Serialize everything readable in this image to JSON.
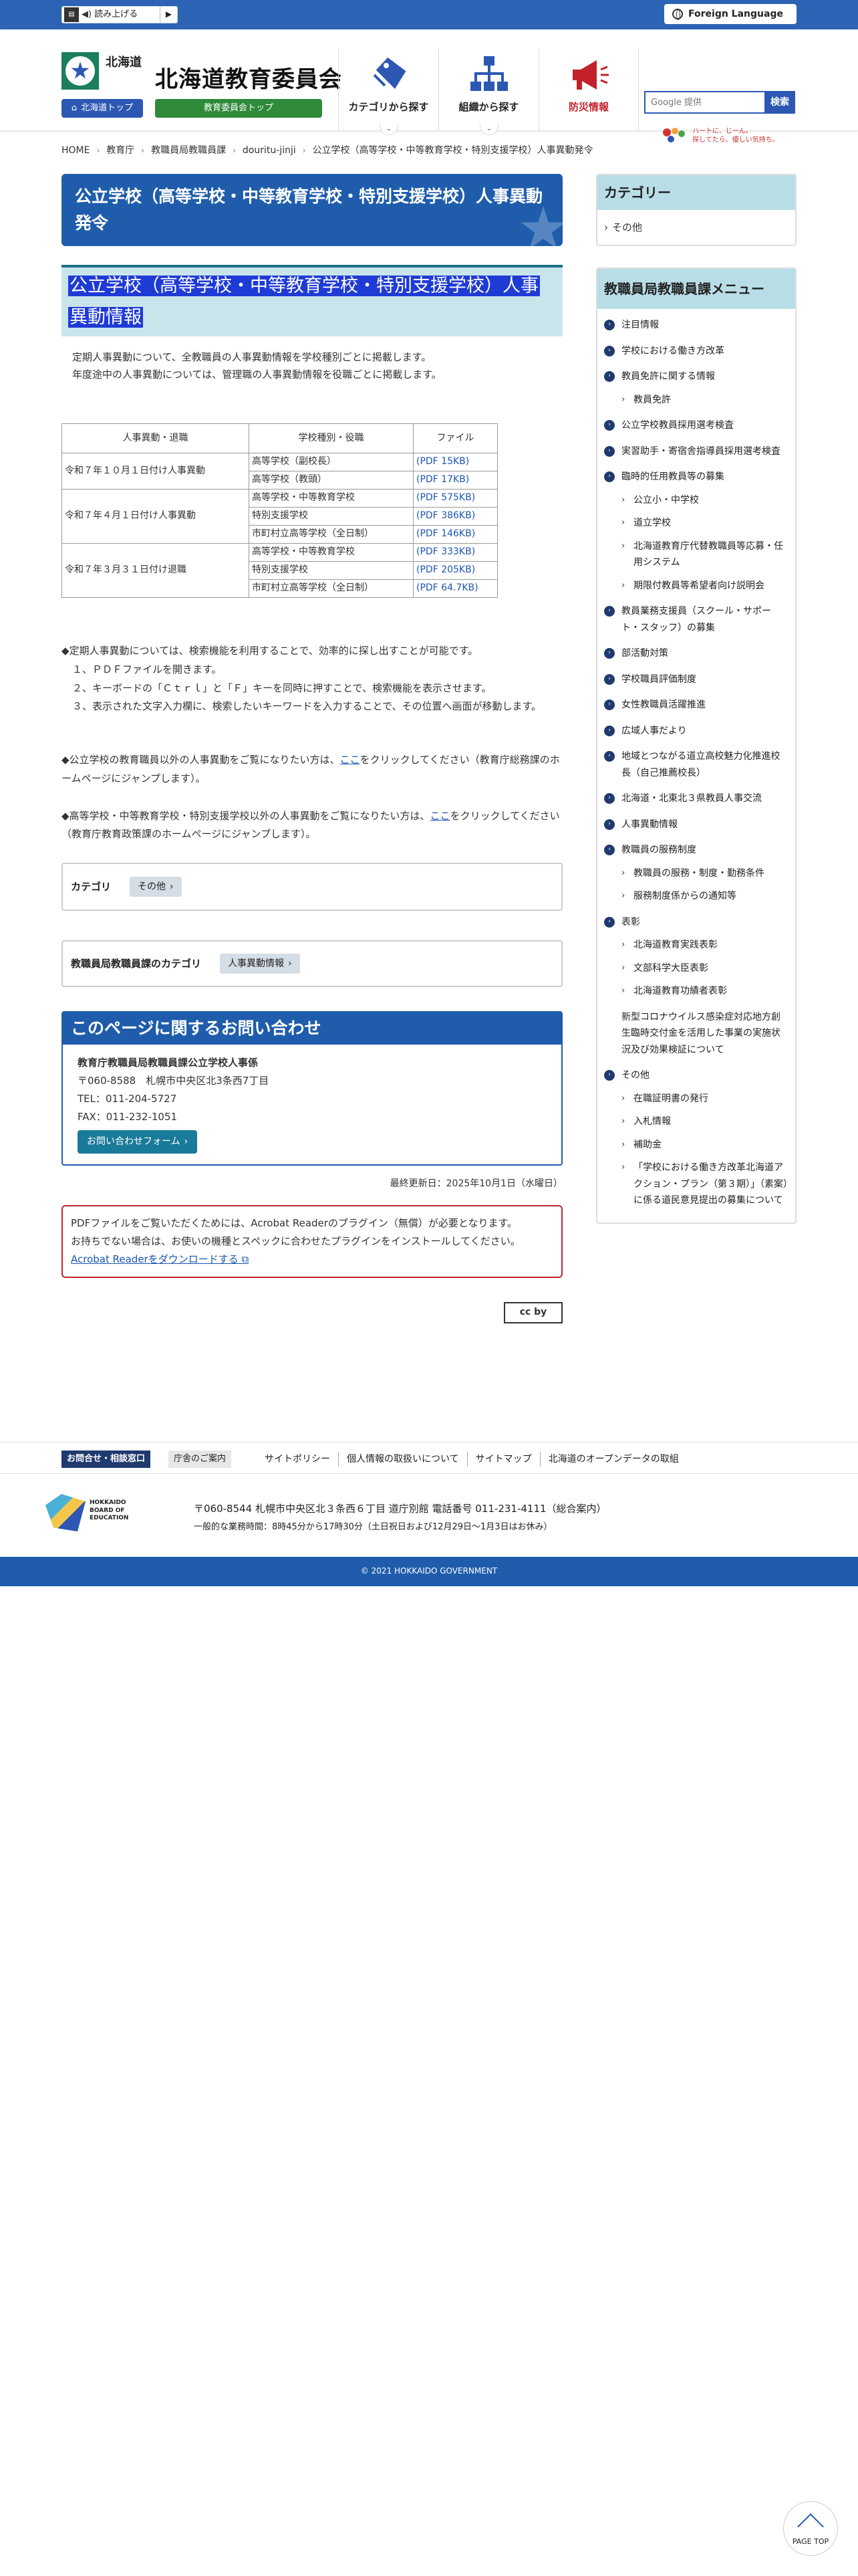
{
  "topbar": {
    "read_aloud": "読み上げる",
    "foreign_language": "Foreign Language"
  },
  "header": {
    "hokkaido": "北海道",
    "hokkaido_top": "北海道トップ",
    "board_title": "北海道教育委員会",
    "board_top": "教育委員会トップ",
    "nav": [
      "カテゴリから探す",
      "組織から探す",
      "防災情報"
    ],
    "search_placeholder": "Google 提供",
    "search_button": "検索",
    "slogan": [
      "ハートに、じーん。",
      "探してたら、優しい気持ち。"
    ]
  },
  "breadcrumb": [
    "HOME",
    "教育庁",
    "教職員局教職員課",
    "douritu-jinji",
    "公立学校（高等学校・中等教育学校・特別支援学校）人事異動発令"
  ],
  "main": {
    "page_title": "公立学校（高等学校・中等教育学校・特別支援学校）人事異動発令",
    "section_title": "公立学校（高等学校・中等教育学校・特別支援学校）人事異動情報",
    "intro": [
      "定期人事異動について、全教職員の人事異動情報を学校種別ごとに掲載します。",
      "年度途中の人事異動については、管理職の人事異動情報を役職ごとに掲載します。"
    ],
    "table": {
      "headers": [
        "人事異動・退職",
        "学校種別・役職",
        "ファイル"
      ],
      "groups": [
        {
          "label": "令和７年１０月１日付け人事異動",
          "rows": [
            {
              "type": "高等学校（副校長）",
              "file": "(PDF 15KB)"
            },
            {
              "type": "高等学校（教頭）",
              "file": "(PDF 17KB)"
            }
          ]
        },
        {
          "label": "令和７年４月１日付け人事異動",
          "rows": [
            {
              "type": "高等学校・中等教育学校",
              "file": "(PDF 575KB)"
            },
            {
              "type": "特別支援学校",
              "file": "(PDF 386KB)"
            },
            {
              "type": "市町村立高等学校（全日制）",
              "file": "(PDF 146KB)"
            }
          ]
        },
        {
          "label": "令和７年３月３１日付け退職",
          "rows": [
            {
              "type": "高等学校・中等教育学校",
              "file": "(PDF 333KB)"
            },
            {
              "type": "特別支援学校",
              "file": "(PDF 205KB)"
            },
            {
              "type": "市町村立高等学校（全日制）",
              "file": "(PDF 64.7KB)"
            }
          ]
        }
      ]
    },
    "notes": {
      "lead": "◆定期人事異動については、検索機能を利用することで、効率的に探し出すことが可能です。",
      "steps": [
        "１、ＰＤＦファイルを開きます。",
        "２、キーボードの「Ｃｔｒｌ」と「Ｆ」キーを同時に押すことで、検索機能を表示させます。",
        "３、表示された文字入力欄に、検索したいキーワードを入力することで、その位置へ画面が移動します。"
      ]
    },
    "link_para1": {
      "before": "◆公立学校の教育職員以外の人事異動をご覧になりたい方は、",
      "link": "ここ",
      "after": "をクリックしてください（教育庁総務課のホームページにジャンプします）。"
    },
    "link_para2": {
      "before": "◆高等学校・中等教育学校・特別支援学校以外の人事異動をご覧になりたい方は、",
      "link": "ここ",
      "after": "をクリックしてください（教育庁教育政策課のホームページにジャンプします）。"
    },
    "category_label": "カテゴリ",
    "category_tag": "その他",
    "dept_category_label": "教職員局教職員課のカテゴリ",
    "dept_category_tag": "人事異動情報",
    "contact": {
      "heading": "このページに関するお問い合わせ",
      "dept": "教育庁教職員局教職員課公立学校人事係",
      "address": "〒060-8588　札幌市中央区北3条西7丁目",
      "tel": "TEL：011-204-5727",
      "fax": "FAX：011-232-1051",
      "form_button": "お問い合わせフォーム"
    },
    "updated": "最終更新日：2025年10月1日（水曜日）",
    "pdf_note": {
      "line1": "PDFファイルをご覧いただくためには、Acrobat Readerのプラグイン（無償）が必要となります。",
      "line2": "お持ちでない場合は、お使いの機種とスペックに合わせたプラグインをインストールしてください。",
      "link": "Acrobat Readerをダウンロードする"
    },
    "cc_label": "cc by"
  },
  "sidebar": {
    "category_heading": "カテゴリー",
    "category_item": "その他",
    "menu_heading": "教職員局教職員課メニュー",
    "menu": [
      {
        "label": "注目情報",
        "subs": []
      },
      {
        "label": "学校における働き方改革",
        "subs": []
      },
      {
        "label": "教員免許に関する情報",
        "subs": [
          "教員免許"
        ]
      },
      {
        "label": "公立学校教員採用選考検査",
        "subs": []
      },
      {
        "label": "実習助手・寄宿舎指導員採用選考検査",
        "subs": []
      },
      {
        "label": "臨時的任用教員等の募集",
        "subs": [
          "公立小・中学校",
          "道立学校",
          "北海道教育庁代替教職員等応募・任用システム",
          "期限付教員等希望者向け説明会"
        ]
      },
      {
        "label": "教員業務支援員（スクール・サポート・スタッフ）の募集",
        "subs": []
      },
      {
        "label": "部活動対策",
        "subs": []
      },
      {
        "label": "学校職員評価制度",
        "subs": []
      },
      {
        "label": "女性教職員活躍推進",
        "subs": []
      },
      {
        "label": "広域人事だより",
        "subs": []
      },
      {
        "label": "地域とつながる道立高校魅力化推進校長（自己推薦校長）",
        "subs": []
      },
      {
        "label": "北海道・北東北３県教員人事交流",
        "subs": []
      },
      {
        "label": "人事異動情報",
        "subs": []
      },
      {
        "label": "教職員の服務制度",
        "subs": [
          "教職員の服務・制度・勤務条件",
          "服務制度係からの通知等"
        ]
      },
      {
        "label": "表彰",
        "subs": [
          "北海道教育実践表彰",
          "文部科学大臣表彰",
          "北海道教育功績者表彰"
        ]
      },
      {
        "label": "新型コロナウイルス感染症対応地方創生臨時交付金を活用した事業の実施状況及び効果検証について",
        "subs": [],
        "nodot": true
      },
      {
        "label": "その他",
        "subs": [
          "在職証明書の発行",
          "入札情報",
          "補助金",
          "「学校における働き方改革北海道アクション・プラン（第３期）」（素案）に係る道民意見提出の募集について"
        ]
      }
    ]
  },
  "footer": {
    "contact_btn": "お問合せ・相談窓口",
    "office_btn": "庁舎のご案内",
    "links": [
      "サイトポリシー",
      "個人情報の取扱いについて",
      "サイトマップ",
      "北海道のオープンデータの取組"
    ],
    "logo_text": [
      "HOKKAIDO",
      "BOARD OF",
      "EDUCATION"
    ],
    "address": "〒060-8544 札幌市中央区北３条西６丁目 道庁別館  電話番号 011-231-4111（総合案内）",
    "hours": "一般的な業務時間：8時45分から17時30分（土日祝日および12月29日～1月3日はお休み）",
    "copyright": "© 2021 HOKKAIDO GOVERNMENT"
  },
  "pagetop": "PAGE TOP"
}
